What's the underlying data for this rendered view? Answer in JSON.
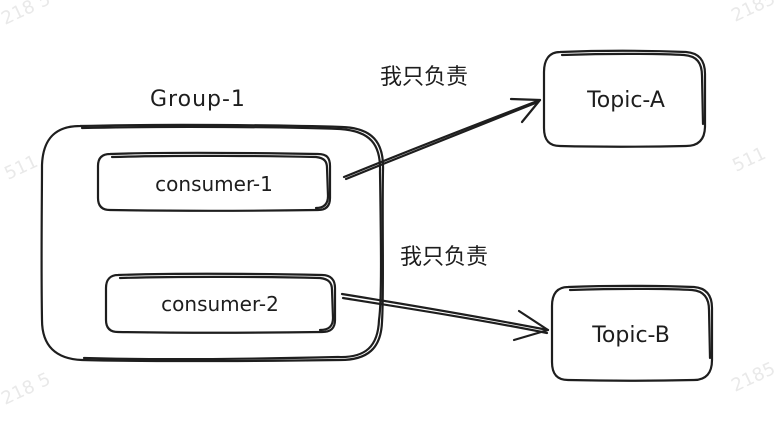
{
  "diagram": {
    "group": {
      "label": "Group-1",
      "consumers": [
        {
          "label": "consumer-1"
        },
        {
          "label": "consumer-2"
        }
      ]
    },
    "topics": [
      {
        "label": "Topic-A"
      },
      {
        "label": "Topic-B"
      }
    ],
    "edges": [
      {
        "from": "consumer-1",
        "to": "Topic-A",
        "label": "我只负责"
      },
      {
        "from": "consumer-2",
        "to": "Topic-B",
        "label": "我只负责"
      }
    ]
  },
  "watermark": [
    "218 5",
    "2185",
    "511",
    "511",
    "2185",
    "218 5"
  ],
  "colors": {
    "stroke": "#1e1e1e",
    "background": "#ffffff",
    "watermark": "#e9e9e9"
  }
}
